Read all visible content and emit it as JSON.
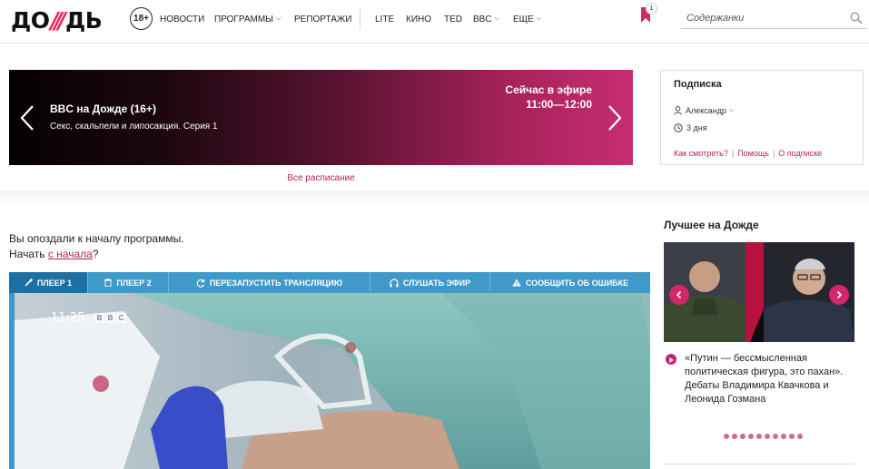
{
  "brand": {
    "logo_pre": "ДО",
    "logo_slash": "///",
    "logo_post": "ДЬ",
    "age_rating": "18+"
  },
  "nav": {
    "items": [
      {
        "label": "НОВОСТИ",
        "dropdown": false
      },
      {
        "label": "ПРОГРАММЫ",
        "dropdown": true
      },
      {
        "label": "РЕПОРТАЖИ",
        "dropdown": false
      },
      {
        "label": "LITE",
        "dropdown": false
      },
      {
        "label": "КИНО",
        "dropdown": false
      },
      {
        "label": "TED",
        "dropdown": false
      },
      {
        "label": "BBC",
        "dropdown": true
      },
      {
        "label": "ЕЩЕ",
        "dropdown": true
      }
    ],
    "bookmark_count": "1"
  },
  "search": {
    "placeholder": "Содержанки",
    "icon": "search-icon"
  },
  "hero": {
    "title": "BBC на Дожде (16+)",
    "subtitle": "Секс, скальпели и липосакция. Серия 1",
    "live_label": "Сейчас в эфире",
    "time": "11:00—12:00",
    "schedule_link": "Все расписание"
  },
  "subscription": {
    "title": "Подписка",
    "user": "Александр",
    "duration": "3 дня",
    "links": [
      "Как смотреть?",
      "Помощь",
      "О подписке"
    ],
    "link_separator": "|"
  },
  "notice": {
    "line1": "Вы опоздали к началу программы.",
    "line2_prefix": "Начать ",
    "line2_link": "с начала",
    "line2_suffix": "?"
  },
  "player": {
    "tabs": [
      {
        "label": "ПЛЕЕР 1",
        "icon": "wrench-icon",
        "active": true
      },
      {
        "label": "ПЛЕЕР 2",
        "icon": "trash-icon",
        "active": false
      },
      {
        "label": "ПЕРЕЗАПУСТИТЬ ТРАНСЛЯЦИЮ",
        "icon": "restart-icon",
        "active": false
      },
      {
        "label": "СЛУШАТЬ ЭФИР",
        "icon": "headphones-icon",
        "active": false
      },
      {
        "label": "СООБЩИТЬ ОБ ОШИБКЕ",
        "icon": "warning-icon",
        "active": false
      }
    ],
    "video_clock": "11:25",
    "video_channel": [
      "B",
      "B",
      "C"
    ]
  },
  "best": {
    "title": "Лучшее на Дожде",
    "caption": "«Путин — бессмысленная политическая фигура, это пахан». Дебаты Владимира Квачкова и Леонида Гозмана",
    "dots": 10
  },
  "colors": {
    "accent": "#c8236a",
    "player_tab": "#3f99c9",
    "player_tab_active": "#1e6fa3",
    "link": "#b0235c"
  }
}
